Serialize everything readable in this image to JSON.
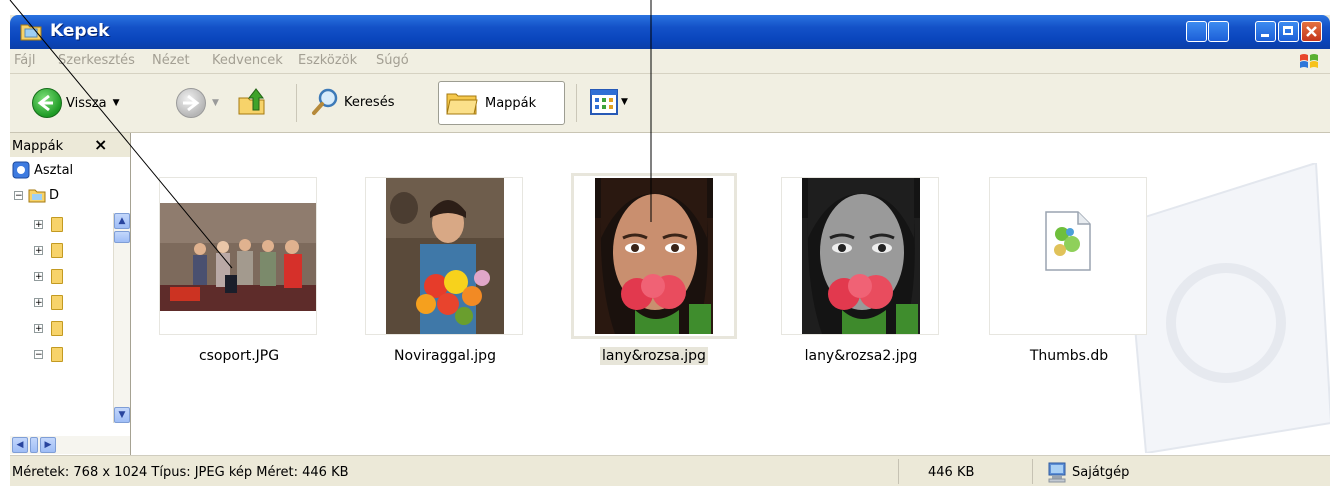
{
  "window": {
    "title": "Kepek"
  },
  "menu": [
    "Fájl",
    "Szerkesztés",
    "Nézet",
    "Kedvencek",
    "Eszközök",
    "Súgó"
  ],
  "toolbar": {
    "back_label": "Vissza",
    "search_label": "Keresés",
    "folders_label": "Mappák"
  },
  "folder_pane": {
    "title": "Mappák",
    "root_label": "Asztal",
    "drive_label": "D"
  },
  "files": [
    {
      "name": "csoport.JPG"
    },
    {
      "name": "Noviraggal.jpg"
    },
    {
      "name": "lany&rozsa.jpg",
      "selected": true
    },
    {
      "name": "lany&rozsa2.jpg"
    },
    {
      "name": "Thumbs.db"
    }
  ],
  "status": {
    "details": "Méretek: 768 x 1024 Típus: JPEG kép Méret: 446 KB",
    "size": "446 KB",
    "location": "Sajátgép"
  },
  "colors": {
    "titlebar": "#0a46bd",
    "chrome": "#ece9d8",
    "accent_green": "#1e9b25"
  }
}
